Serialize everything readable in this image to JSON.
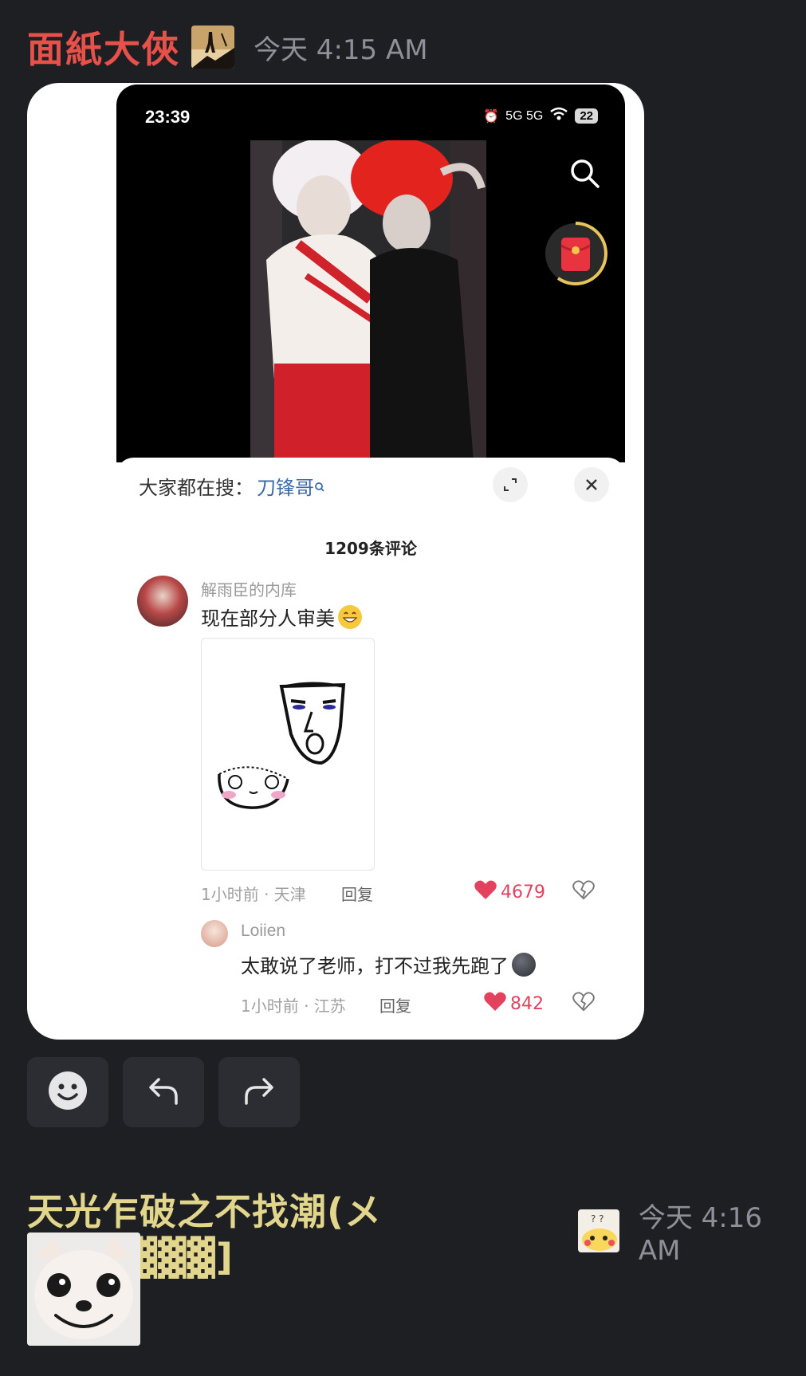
{
  "messages": [
    {
      "author": "面紙大俠",
      "timestamp": "今天 4:15 AM",
      "badge_icon": "silhouette-badge-icon",
      "attachment": {
        "phone": {
          "status_time": "23:39",
          "status_icons": "5G 5G",
          "battery": "22"
        },
        "comment_panel": {
          "hot_search_label": "大家都在搜：",
          "hot_search_term": "刀锋哥",
          "comment_count": "1209条评论",
          "comments": [
            {
              "user": "解雨臣的内库",
              "text": "现在部分人审美",
              "meta": "1小时前 · 天津",
              "reply": "回复",
              "likes": "4679"
            },
            {
              "user": "Loiien",
              "text": "太敢说了老师，打不过我先跑了",
              "meta": "1小时前 · 江苏",
              "reply": "回复",
              "likes": "842"
            }
          ]
        }
      },
      "actions": [
        "emoji-reaction-icon",
        "reply-icon",
        "forward-icon"
      ]
    },
    {
      "author": "天光乍破之不找潮(メ3[▓▓▓▓▓]",
      "timestamp": "今天 4:16 AM",
      "badge_icon": "pikachu-badge-icon",
      "sticker": "chihuahua-sticker"
    }
  ],
  "colors": {
    "background": "#1e1f23",
    "author1": "#e8504a",
    "author2": "#e2d58c",
    "timestamp": "#8e9097",
    "like": "#e2425e"
  }
}
